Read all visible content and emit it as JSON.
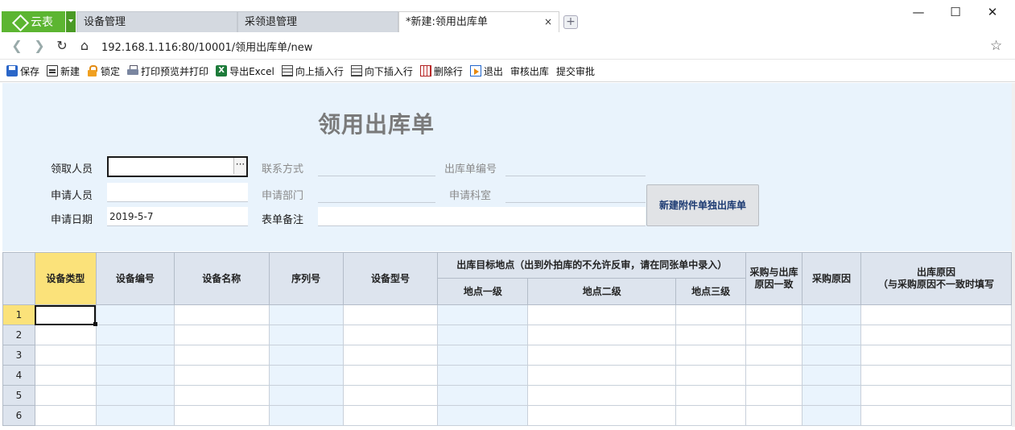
{
  "app": {
    "brand_label": "云表"
  },
  "tabs": [
    {
      "label": "设备管理"
    },
    {
      "label": "采领退管理"
    },
    {
      "label": "*新建:领用出库单",
      "close": "×"
    }
  ],
  "tab_add_label": "+",
  "window_controls": {
    "minimize": "—",
    "maximize": "☐",
    "close": "✕"
  },
  "address": {
    "url": "192.168.1.116:80/10001/领用出库单/new"
  },
  "toolbar": {
    "items": [
      {
        "label": "保存",
        "icon": "save-icon"
      },
      {
        "label": "新建",
        "icon": "new-icon"
      },
      {
        "label": "锁定",
        "icon": "lock-icon"
      },
      {
        "label": "打印预览并打印",
        "icon": "print-icon"
      },
      {
        "label": "导出Excel",
        "icon": "excel-icon"
      },
      {
        "label": "向上插入行",
        "icon": "insert-row-above-icon"
      },
      {
        "label": "向下插入行",
        "icon": "insert-row-below-icon"
      },
      {
        "label": "删除行",
        "icon": "delete-row-icon"
      },
      {
        "label": "退出",
        "icon": "exit-icon"
      },
      {
        "label": "审核出库"
      },
      {
        "label": "提交审批"
      }
    ]
  },
  "form": {
    "title": "领用出库单",
    "fields": {
      "receiver": {
        "label": "领取人员",
        "value": ""
      },
      "contact": {
        "label": "联系方式",
        "value": ""
      },
      "order_no": {
        "label": "出库单编号",
        "value": ""
      },
      "applicant": {
        "label": "申请人员",
        "value": ""
      },
      "department": {
        "label": "申请部门",
        "value": ""
      },
      "section": {
        "label": "申请科室",
        "value": ""
      },
      "apply_date": {
        "label": "申请日期",
        "value": "2019-5-7"
      },
      "remark": {
        "label": "表单备注",
        "value": ""
      }
    },
    "lookup_label": "···",
    "attach_button": "新建附件单独出库单"
  },
  "grid": {
    "columns": {
      "device_type": "设备类型",
      "device_no": "设备编号",
      "device_name": "设备名称",
      "serial_no": "序列号",
      "model": "设备型号",
      "target_group": "出库目标地点（出到外拍库的不允许反审，请在同张单中录入）",
      "loc1": "地点一级",
      "loc2": "地点二级",
      "loc3": "地点三级",
      "consistent": "采购与出库原因一致",
      "purchase_reason": "采购原因",
      "out_reason": "出库原因",
      "out_reason_note": "（与采购原因不一致时填写"
    },
    "rows": [
      "1",
      "2",
      "3",
      "4",
      "5",
      "6"
    ]
  }
}
